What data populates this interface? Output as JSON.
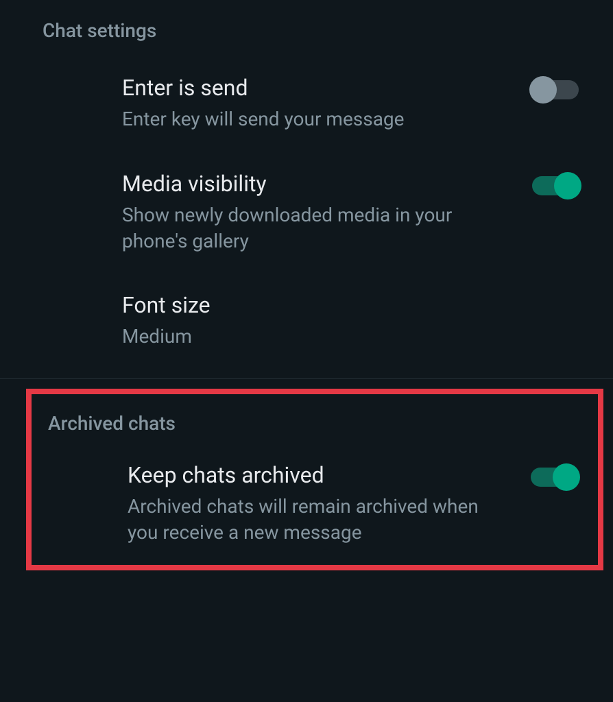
{
  "sections": {
    "chat_settings": {
      "header": "Chat settings",
      "items": [
        {
          "title": "Enter is send",
          "subtitle": "Enter key will send your message",
          "toggle": "off"
        },
        {
          "title": "Media visibility",
          "subtitle": "Show newly downloaded media in your phone's gallery",
          "toggle": "on"
        },
        {
          "title": "Font size",
          "subtitle": "Medium",
          "toggle": null
        }
      ]
    },
    "archived_chats": {
      "header": "Archived chats",
      "items": [
        {
          "title": "Keep chats archived",
          "subtitle": "Archived chats will remain archived when you receive a new message",
          "toggle": "on"
        }
      ]
    }
  }
}
